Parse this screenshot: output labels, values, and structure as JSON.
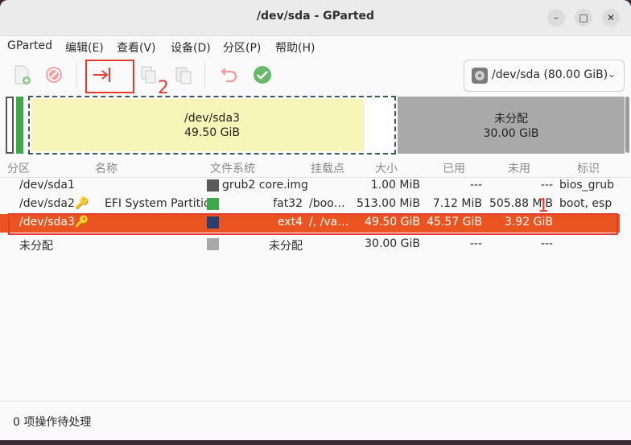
{
  "window": {
    "title": "/dev/sda - GParted",
    "controls": {
      "minimize": "–",
      "maximize": "□",
      "close": "✕"
    }
  },
  "menubar": {
    "items": [
      "GParted",
      "编辑(E)",
      "查看(V)",
      "设备(D)",
      "分区(P)",
      "帮助(H)"
    ]
  },
  "toolbar": {
    "device_label": "/dev/sda (80.00 GiB)",
    "dropdown_icon": "chevron-down-icon",
    "annotation_number": "2"
  },
  "diskmap": {
    "sda3": {
      "name": "/dev/sda3",
      "size": "49.50 GiB"
    },
    "unallocated": {
      "name": "未分配",
      "size": "30.00 GiB"
    }
  },
  "table": {
    "headers": [
      "分区",
      "名称",
      "文件系统",
      "挂载点",
      "大小",
      "已用",
      "未用",
      "标识"
    ],
    "rows": [
      {
        "partition": "/dev/sda1",
        "name": "",
        "filesystem": "grub2 core.img",
        "mount": "",
        "size": "1.00 MiB",
        "used": "---",
        "unused": "---",
        "flags": "bios_grub"
      },
      {
        "partition": "/dev/sda2",
        "name": "EFI System Partition",
        "filesystem": "fat32",
        "mount": "/boo…",
        "size": "513.00 MiB",
        "used": "7.12 MiB",
        "unused": "505.88 MiB",
        "flags": "boot, esp"
      },
      {
        "partition": "/dev/sda3",
        "name": "",
        "filesystem": "ext4",
        "mount": "/, /va…",
        "size": "49.50 GiB",
        "used": "45.57 GiB",
        "unused": "3.92 GiB",
        "flags": ""
      },
      {
        "partition": "未分配",
        "name": "",
        "filesystem": "未分配",
        "mount": "",
        "size": "30.00 GiB",
        "used": "---",
        "unused": "---",
        "flags": ""
      }
    ],
    "annotation_number": "1"
  },
  "colors": {
    "selection": "#e95420",
    "grub": "#5a5a5a",
    "fat32": "#3ea84a",
    "ext4": "#2c3e6b",
    "unallocated": "#a9a9a9",
    "highlight": "#e53b2e"
  },
  "statusbar": {
    "text": "0 项操作待处理"
  }
}
